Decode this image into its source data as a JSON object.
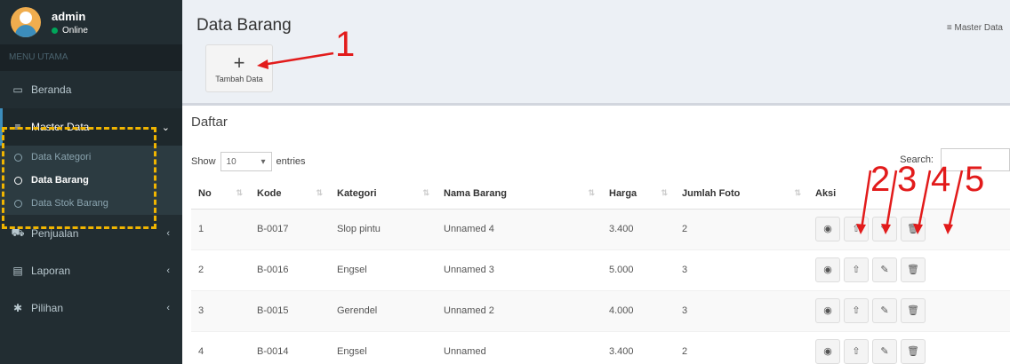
{
  "user": {
    "name": "admin",
    "status": "Online"
  },
  "sidebar": {
    "header": "MENU UTAMA",
    "items": [
      {
        "label": "Beranda",
        "icon": "monitor-icon"
      },
      {
        "label": "Master Data",
        "icon": "bars-icon"
      },
      {
        "label": "Penjualan",
        "icon": "cart-icon"
      },
      {
        "label": "Laporan",
        "icon": "file-icon"
      },
      {
        "label": "Pilihan",
        "icon": "gear-icon"
      }
    ],
    "submenu": [
      "Data Kategori",
      "Data Barang",
      "Data Stok Barang"
    ]
  },
  "page": {
    "title": "Data Barang",
    "breadcrumb": "Master Data",
    "add_label": "Tambah Data"
  },
  "annotations": [
    "1",
    "2",
    "3",
    "4",
    "5"
  ],
  "box": {
    "title": "Daftar"
  },
  "table_controls": {
    "show": "Show",
    "entries_value": "10",
    "entries": "entries",
    "search": "Search:"
  },
  "table": {
    "headers": [
      "No",
      "Kode",
      "Kategori",
      "Nama Barang",
      "Harga",
      "Jumlah Foto",
      "Aksi"
    ],
    "rows": [
      [
        "1",
        "B-0017",
        "Slop pintu",
        "Unnamed 4",
        "3.400",
        "2"
      ],
      [
        "2",
        "B-0016",
        "Engsel",
        "Unnamed 3",
        "5.000",
        "3"
      ],
      [
        "3",
        "B-0015",
        "Gerendel",
        "Unnamed 2",
        "4.000",
        "3"
      ],
      [
        "4",
        "B-0014",
        "Engsel",
        "Unnamed",
        "3.400",
        "2"
      ]
    ],
    "actions": [
      "eye-icon",
      "upload-icon",
      "edit-icon",
      "trash-icon"
    ]
  },
  "colors": {
    "sidebar": "#222d32",
    "accent": "#3c8dbc",
    "highlight": "#f0b400",
    "annotation": "#e21b1b"
  }
}
